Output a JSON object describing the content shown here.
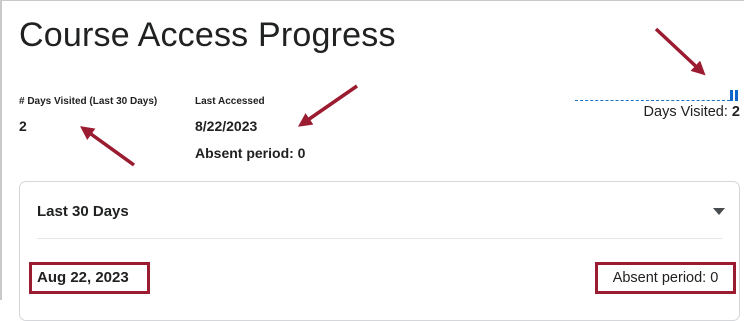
{
  "title": "Course Access Progress",
  "stats": {
    "days_visited_label": "# Days Visited (Last 30 Days)",
    "days_visited_value": "2",
    "last_accessed_label": "Last Accessed",
    "last_accessed_value": "8/22/2023",
    "absent_period_text": "Absent period: 0"
  },
  "sparkline": {
    "caption_label": "Days Visited:",
    "caption_value": "2",
    "bar_color": "#1167c9"
  },
  "panel": {
    "header_label": "Last 30 Days",
    "expanded": true,
    "rows": [
      {
        "date": "Aug 22, 2023",
        "absent_text": "Absent period: 0"
      }
    ]
  },
  "colors": {
    "annotation": "#9b1b30",
    "text": "#202122"
  }
}
